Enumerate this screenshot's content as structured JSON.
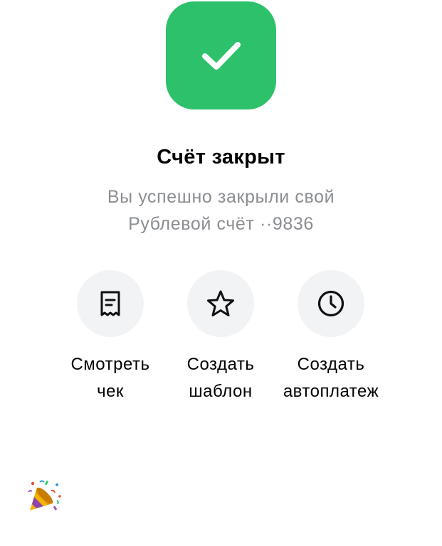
{
  "status": {
    "icon": "checkmark-icon",
    "color": "#2ec16c"
  },
  "title": "Счёт закрыт",
  "subtitle": {
    "line1": "Вы успешно закрыли свой",
    "line2": "Рублевой счёт ··9836"
  },
  "actions": [
    {
      "icon": "receipt-icon",
      "line1": "Смотреть",
      "line2": "чек"
    },
    {
      "icon": "star-icon",
      "line1": "Создать",
      "line2": "шаблон"
    },
    {
      "icon": "clock-icon",
      "line1": "Создать",
      "line2": "автоплатеж"
    }
  ],
  "decoration": {
    "icon": "party-popper-icon"
  }
}
